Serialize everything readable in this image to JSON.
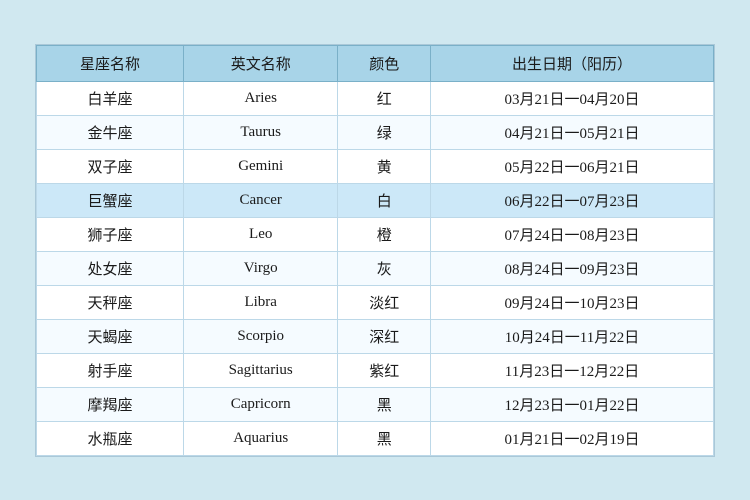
{
  "table": {
    "headers": [
      "星座名称",
      "英文名称",
      "颜色",
      "出生日期（阳历）"
    ],
    "rows": [
      {
        "zh": "白羊座",
        "en": "Aries",
        "color": "红",
        "date": "03月21日一04月20日",
        "highlight": false
      },
      {
        "zh": "金牛座",
        "en": "Taurus",
        "color": "绿",
        "date": "04月21日一05月21日",
        "highlight": false
      },
      {
        "zh": "双子座",
        "en": "Gemini",
        "color": "黄",
        "date": "05月22日一06月21日",
        "highlight": false
      },
      {
        "zh": "巨蟹座",
        "en": "Cancer",
        "color": "白",
        "date": "06月22日一07月23日",
        "highlight": true
      },
      {
        "zh": "狮子座",
        "en": "Leo",
        "color": "橙",
        "date": "07月24日一08月23日",
        "highlight": false
      },
      {
        "zh": "处女座",
        "en": "Virgo",
        "color": "灰",
        "date": "08月24日一09月23日",
        "highlight": false
      },
      {
        "zh": "天秤座",
        "en": "Libra",
        "color": "淡红",
        "date": "09月24日一10月23日",
        "highlight": false
      },
      {
        "zh": "天蝎座",
        "en": "Scorpio",
        "color": "深红",
        "date": "10月24日一11月22日",
        "highlight": false
      },
      {
        "zh": "射手座",
        "en": "Sagittarius",
        "color": "紫红",
        "date": "11月23日一12月22日",
        "highlight": false
      },
      {
        "zh": "摩羯座",
        "en": "Capricorn",
        "color": "黑",
        "date": "12月23日一01月22日",
        "highlight": false
      },
      {
        "zh": "水瓶座",
        "en": "Aquarius",
        "color": "黑",
        "date": "01月21日一02月19日",
        "highlight": false
      }
    ]
  }
}
